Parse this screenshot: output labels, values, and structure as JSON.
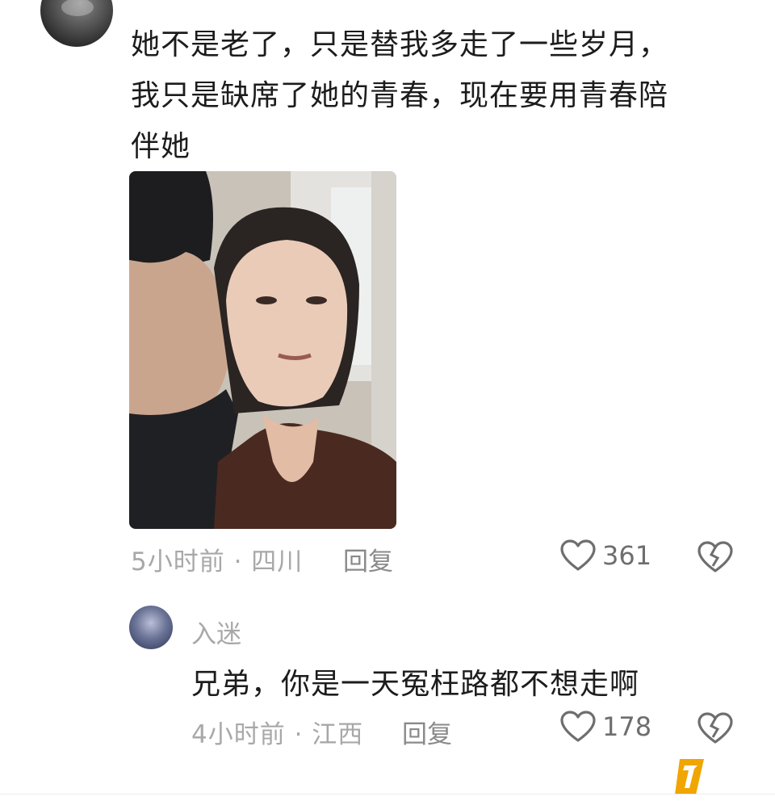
{
  "comment": {
    "line1": "她不是老了，只是替我多走了一些岁月，",
    "line2": "我只是缺席了她的青春，现在要用青春陪",
    "line3": "伴她",
    "time_location": "5小时前 · 四川",
    "reply_label": "回复",
    "like_count": "361",
    "icons": [
      "heart-icon",
      "broken-heart-icon"
    ]
  },
  "reply": {
    "username": "入迷",
    "text": "兄弟，你是一天冤枉路都不想走啊",
    "time_location": "4小时前 · 江西",
    "reply_label": "回复",
    "like_count": "178"
  },
  "colors": {
    "text": "#1c1c1c",
    "meta": "#a8a8a8",
    "icon": "#6e6e6e",
    "watermark_logo": "#f0a500"
  }
}
